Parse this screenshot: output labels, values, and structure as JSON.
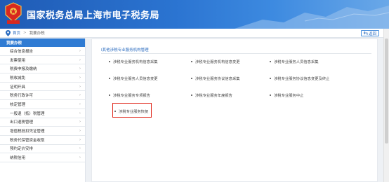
{
  "header": {
    "title": "国家税务总局上海市电子税务局",
    "emblem_caption": "中国税务"
  },
  "breadcrumb": {
    "home": "首页",
    "separator": ">",
    "current": "我要办税",
    "back_label": "返回"
  },
  "sidebar": {
    "heading": "我要办税",
    "items": [
      {
        "label": "综合信息报告"
      },
      {
        "label": "发票使用"
      },
      {
        "label": "税费申报及缴纳"
      },
      {
        "label": "税收减免"
      },
      {
        "label": "证明开具"
      },
      {
        "label": "税务行政许可"
      },
      {
        "label": "核定管理"
      },
      {
        "label": "一般退（抵）税管理"
      },
      {
        "label": "出口退税管理"
      },
      {
        "label": "增值税抵扣凭证管理"
      },
      {
        "label": "税务代保管资金收取"
      },
      {
        "label": "预约定价安排"
      },
      {
        "label": "纳税信用"
      }
    ]
  },
  "main": {
    "section_title": "Ⅰ其他涉税专业服务机构管理",
    "items": [
      {
        "label": "涉税专业服务机构信息采集"
      },
      {
        "label": "涉税专业服务机构信息变更"
      },
      {
        "label": "涉税专业服务人员信息采集"
      },
      {
        "label": "涉税专业服务人员信息变更"
      },
      {
        "label": "涉税专业服务协议信息采集"
      },
      {
        "label": "涉税专业服务协议信息变更及终止"
      },
      {
        "label": "涉税专业服务专项报告"
      },
      {
        "label": "涉税专业服务年度报告"
      },
      {
        "label": "涉税专业服务中止"
      },
      {
        "label": "涉税专业服务恢复"
      }
    ]
  },
  "colors": {
    "brand_blue": "#2f7bd3",
    "highlight_red": "#e0261b"
  }
}
